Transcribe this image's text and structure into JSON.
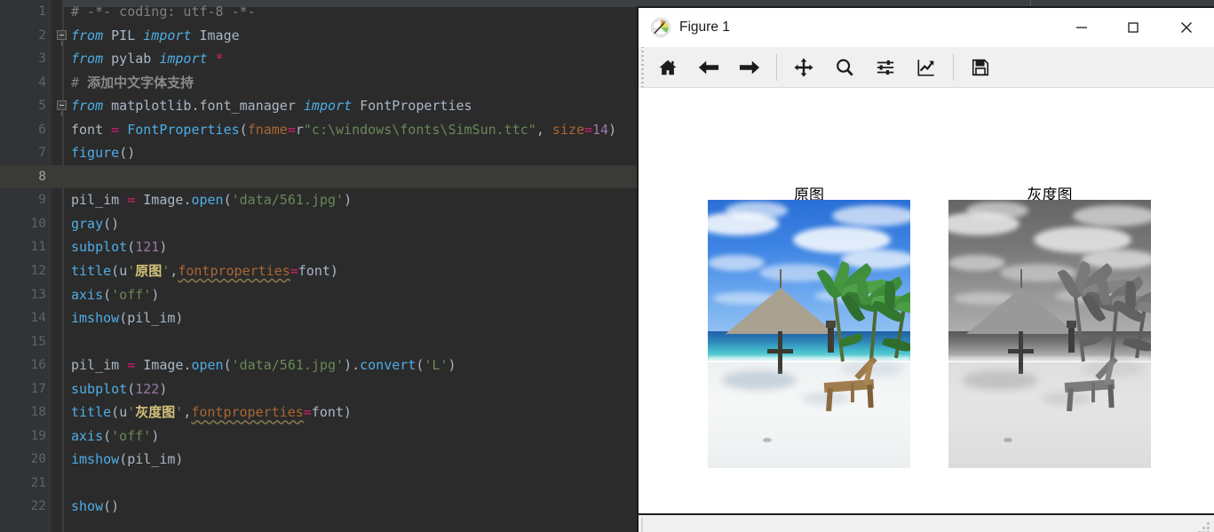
{
  "editor": {
    "name": "python-code-editor",
    "language": "Python",
    "theme": "darcula",
    "background": "#2b2b2b",
    "gutter_background": "#313335",
    "current_line": 8,
    "lines": [
      {
        "n": 1,
        "fold": false,
        "text": "# -*- coding: utf-8 -*-"
      },
      {
        "n": 2,
        "fold": true,
        "text": "from PIL import Image"
      },
      {
        "n": 3,
        "fold": false,
        "text": "from pylab import *"
      },
      {
        "n": 4,
        "fold": false,
        "text": "# 添加中文字体支持"
      },
      {
        "n": 5,
        "fold": true,
        "text": "from matplotlib.font_manager import FontProperties"
      },
      {
        "n": 6,
        "fold": false,
        "text": "font = FontProperties(fname=r\"c:\\windows\\fonts\\SimSun.ttc\", size=14)"
      },
      {
        "n": 7,
        "fold": false,
        "text": "figure()"
      },
      {
        "n": 8,
        "fold": false,
        "text": ""
      },
      {
        "n": 9,
        "fold": false,
        "text": "pil_im = Image.open('data/561.jpg')"
      },
      {
        "n": 10,
        "fold": false,
        "text": "gray()"
      },
      {
        "n": 11,
        "fold": false,
        "text": "subplot(121)"
      },
      {
        "n": 12,
        "fold": false,
        "text": "title(u'原图',fontproperties=font)"
      },
      {
        "n": 13,
        "fold": false,
        "text": "axis('off')"
      },
      {
        "n": 14,
        "fold": false,
        "text": "imshow(pil_im)"
      },
      {
        "n": 15,
        "fold": false,
        "text": ""
      },
      {
        "n": 16,
        "fold": false,
        "text": "pil_im = Image.open('data/561.jpg').convert('L')"
      },
      {
        "n": 17,
        "fold": false,
        "text": "subplot(122)"
      },
      {
        "n": 18,
        "fold": false,
        "text": "title(u'灰度图',fontproperties=font)"
      },
      {
        "n": 19,
        "fold": false,
        "text": "axis('off')"
      },
      {
        "n": 20,
        "fold": false,
        "text": "imshow(pil_im)"
      },
      {
        "n": 21,
        "fold": false,
        "text": ""
      },
      {
        "n": 22,
        "fold": false,
        "text": "show()"
      }
    ],
    "marker_rail": {
      "name": "warning-marker-rail",
      "markers_y_percent": [
        0.8,
        50.0,
        68.5,
        88.5
      ],
      "color": "#f0f0a0"
    }
  },
  "figure_window": {
    "title": "Figure 1",
    "icon": "matplotlib-icon",
    "window_buttons": {
      "minimize": "—",
      "maximize": "☐",
      "close": "✕"
    },
    "toolbar": [
      {
        "name": "home-icon",
        "tooltip": "Reset original view"
      },
      {
        "name": "arrow-left-icon",
        "tooltip": "Back to previous view"
      },
      {
        "name": "arrow-right-icon",
        "tooltip": "Forward to next view"
      },
      {
        "name": "separator",
        "tooltip": ""
      },
      {
        "name": "move-icon",
        "tooltip": "Pan axes with left mouse, zoom with right"
      },
      {
        "name": "magnifier-icon",
        "tooltip": "Zoom to rectangle"
      },
      {
        "name": "sliders-icon",
        "tooltip": "Configure subplots"
      },
      {
        "name": "chart-line-icon",
        "tooltip": "Edit axis, curve and image parameters"
      },
      {
        "name": "separator",
        "tooltip": ""
      },
      {
        "name": "floppy-disk-icon",
        "tooltip": "Save the figure"
      }
    ],
    "status_text": "",
    "canvas_background": "#ffffff"
  },
  "chart_data": {
    "type": "image",
    "title": "",
    "layout": "subplot(1,2)",
    "colormap": "gray",
    "axes_visible": false,
    "subplots": [
      {
        "index": 1,
        "code_position": "subplot(121)",
        "title": "原图",
        "title_translation": "Original image",
        "source": "data/561.jpg",
        "mode": "RGB",
        "description": "Tropical beach with blue sky, cumulus clouds, turquoise lagoon, thatched palm umbrella, palm trees and a wooden lounge chair on white sand"
      },
      {
        "index": 2,
        "code_position": "subplot(122)",
        "title": "灰度图",
        "title_translation": "Grayscale image",
        "source": "data/561.jpg",
        "mode": "L",
        "description": "Same beach scene converted to 8-bit grayscale"
      }
    ]
  }
}
